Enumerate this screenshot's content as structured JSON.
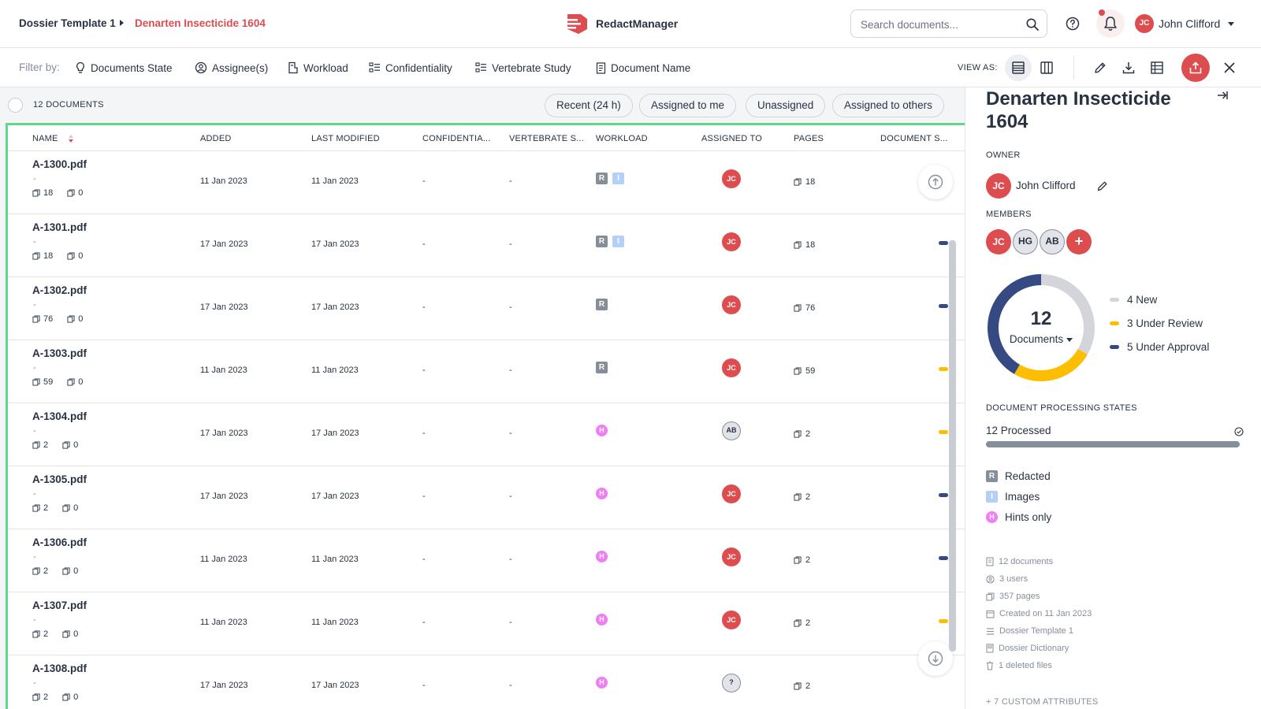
{
  "header": {
    "breadcrumb_template": "Dossier Template 1",
    "breadcrumb_dossier": "Denarten Insecticide 1604",
    "app_name": "RedactManager",
    "search_placeholder": "Search documents...",
    "user_initials": "JC",
    "user_name": "John Clifford"
  },
  "filters": {
    "label": "Filter by:",
    "items": [
      "Documents State",
      "Assignee(s)",
      "Workload",
      "Confidentiality",
      "Vertebrate Study",
      "Document Name"
    ],
    "view_as_label": "VIEW AS:"
  },
  "list": {
    "count_label": "12 DOCUMENTS",
    "quick_filters": [
      "Recent (24 h)",
      "Assigned to me",
      "Unassigned",
      "Assigned to others"
    ],
    "columns": [
      "NAME",
      "ADDED",
      "LAST MODIFIED",
      "CONFIDENTIA...",
      "VERTEBRATE S...",
      "WORKLOAD",
      "ASSIGNED TO",
      "PAGES",
      "DOCUMENT S..."
    ],
    "rows": [
      {
        "name": "A-1300.pdf",
        "dash": "-",
        "pages_meta": "18",
        "annot_meta": "0",
        "added": "11 Jan 2023",
        "modified": "11 Jan 2023",
        "confidentiality": "-",
        "vertebrate": "-",
        "workload": [
          "R",
          "I"
        ],
        "assignee": "JC",
        "assignee_style": "red",
        "pages": "18",
        "state": "none"
      },
      {
        "name": "A-1301.pdf",
        "dash": "-",
        "pages_meta": "18",
        "annot_meta": "0",
        "added": "17 Jan 2023",
        "modified": "17 Jan 2023",
        "confidentiality": "-",
        "vertebrate": "-",
        "workload": [
          "R",
          "I"
        ],
        "assignee": "JC",
        "assignee_style": "red",
        "pages": "18",
        "state": "approval"
      },
      {
        "name": "A-1302.pdf",
        "dash": "-",
        "pages_meta": "76",
        "annot_meta": "0",
        "added": "17 Jan 2023",
        "modified": "17 Jan 2023",
        "confidentiality": "-",
        "vertebrate": "-",
        "workload": [
          "R"
        ],
        "assignee": "JC",
        "assignee_style": "red",
        "pages": "76",
        "state": "approval"
      },
      {
        "name": "A-1303.pdf",
        "dash": "-",
        "pages_meta": "59",
        "annot_meta": "0",
        "added": "11 Jan 2023",
        "modified": "11 Jan 2023",
        "confidentiality": "-",
        "vertebrate": "-",
        "workload": [
          "R"
        ],
        "assignee": "JC",
        "assignee_style": "red",
        "pages": "59",
        "state": "review"
      },
      {
        "name": "A-1304.pdf",
        "dash": "-",
        "pages_meta": "2",
        "annot_meta": "0",
        "added": "17 Jan 2023",
        "modified": "17 Jan 2023",
        "confidentiality": "-",
        "vertebrate": "-",
        "workload": [
          "H"
        ],
        "assignee": "AB",
        "assignee_style": "grey",
        "pages": "2",
        "state": "review"
      },
      {
        "name": "A-1305.pdf",
        "dash": "-",
        "pages_meta": "2",
        "annot_meta": "0",
        "added": "17 Jan 2023",
        "modified": "17 Jan 2023",
        "confidentiality": "-",
        "vertebrate": "-",
        "workload": [
          "H"
        ],
        "assignee": "JC",
        "assignee_style": "red",
        "pages": "2",
        "state": "approval"
      },
      {
        "name": "A-1306.pdf",
        "dash": "-",
        "pages_meta": "2",
        "annot_meta": "0",
        "added": "11 Jan 2023",
        "modified": "11 Jan 2023",
        "confidentiality": "-",
        "vertebrate": "-",
        "workload": [
          "H"
        ],
        "assignee": "JC",
        "assignee_style": "red",
        "pages": "2",
        "state": "approval"
      },
      {
        "name": "A-1307.pdf",
        "dash": "-",
        "pages_meta": "2",
        "annot_meta": "0",
        "added": "11 Jan 2023",
        "modified": "11 Jan 2023",
        "confidentiality": "-",
        "vertebrate": "-",
        "workload": [
          "H"
        ],
        "assignee": "JC",
        "assignee_style": "red",
        "pages": "2",
        "state": "review"
      },
      {
        "name": "A-1308.pdf",
        "dash": "-",
        "pages_meta": "2",
        "annot_meta": "0",
        "added": "17 Jan 2023",
        "modified": "17 Jan 2023",
        "confidentiality": "-",
        "vertebrate": "-",
        "workload": [
          "H"
        ],
        "assignee": "?",
        "assignee_style": "grey",
        "pages": "2",
        "state": "none"
      }
    ]
  },
  "panel": {
    "title": "Denarten Insecticide 1604",
    "owner_label": "OWNER",
    "owner_initials": "JC",
    "owner_name": "John Clifford",
    "members_label": "MEMBERS",
    "members": [
      "JC",
      "HG",
      "AB"
    ],
    "add_member": "+",
    "chart_data": {
      "type": "pie",
      "center_value": "12",
      "center_label": "Documents",
      "series": [
        {
          "name": "New",
          "value": 4,
          "color": "#d3d5da",
          "label": "4 New"
        },
        {
          "name": "Under Review",
          "value": 3,
          "color": "#fdbd00",
          "label": "3 Under Review"
        },
        {
          "name": "Under Approval",
          "value": 5,
          "color": "#354a83",
          "label": "5 Under Approval"
        }
      ]
    },
    "processing_label": "DOCUMENT PROCESSING STATES",
    "processing_text": "12 Processed",
    "processing_fraction": 1.0,
    "workload_key": [
      {
        "badge": "R",
        "label": "Redacted"
      },
      {
        "badge": "I",
        "label": "Images"
      },
      {
        "badge": "H",
        "label": "Hints only"
      }
    ],
    "stats": [
      "12 documents",
      "3 users",
      "357 pages",
      "Created on 11 Jan 2023",
      "Dossier Template 1",
      "Dossier Dictionary",
      "1 deleted files"
    ],
    "custom_attributes": "+ 7 CUSTOM ATTRIBUTES"
  },
  "colors": {
    "accent": "#dd4d50",
    "state_approval": "#354a83",
    "state_review": "#fdbd00",
    "highlight_frame": "#5ed88b"
  }
}
